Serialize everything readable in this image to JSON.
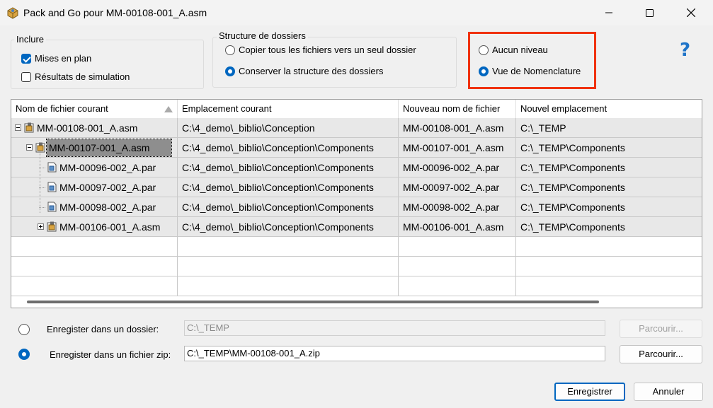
{
  "window": {
    "title": "Pack and Go pour MM-00108-001_A.asm"
  },
  "inclure": {
    "label": "Inclure",
    "options": [
      {
        "label": "Mises en plan",
        "checked": true
      },
      {
        "label": "Résultats de simulation",
        "checked": false
      }
    ]
  },
  "structure": {
    "label": "Structure de dossiers",
    "options": [
      {
        "label": "Copier tous les fichiers vers un seul dossier",
        "selected": false
      },
      {
        "label": "Conserver la structure des dossiers",
        "selected": true
      }
    ]
  },
  "niveau": {
    "options": [
      {
        "label": "Aucun niveau",
        "selected": false
      },
      {
        "label": "Vue de Nomenclature",
        "selected": true
      }
    ]
  },
  "help": {
    "glyph": "?"
  },
  "table": {
    "columns": [
      "Nom de fichier courant",
      "Emplacement courant",
      "Nouveau nom de fichier",
      "Nouvel emplacement"
    ],
    "rows": [
      {
        "name": "MM-00108-001_A.asm",
        "location": "C:\\4_demo\\_biblio\\Conception",
        "new_name": "MM-00108-001_A.asm",
        "new_location": "C:\\_TEMP"
      },
      {
        "name": "MM-00107-001_A.asm",
        "location": "C:\\4_demo\\_biblio\\Conception\\Components",
        "new_name": "MM-00107-001_A.asm",
        "new_location": "C:\\_TEMP\\Components"
      },
      {
        "name": "MM-00096-002_A.par",
        "location": "C:\\4_demo\\_biblio\\Conception\\Components",
        "new_name": "MM-00096-002_A.par",
        "new_location": "C:\\_TEMP\\Components"
      },
      {
        "name": "MM-00097-002_A.par",
        "location": "C:\\4_demo\\_biblio\\Conception\\Components",
        "new_name": "MM-00097-002_A.par",
        "new_location": "C:\\_TEMP\\Components"
      },
      {
        "name": "MM-00098-002_A.par",
        "location": "C:\\4_demo\\_biblio\\Conception\\Components",
        "new_name": "MM-00098-002_A.par",
        "new_location": "C:\\_TEMP\\Components"
      },
      {
        "name": "MM-00106-001_A.asm",
        "location": "C:\\4_demo\\_biblio\\Conception\\Components",
        "new_name": "MM-00106-001_A.asm",
        "new_location": "C:\\_TEMP\\Components"
      }
    ]
  },
  "save_folder": {
    "label": "Enregister dans un dossier:",
    "value": "C:\\_TEMP",
    "browse": "Parcourir...",
    "selected": false
  },
  "save_zip": {
    "label": "Enregister dans un fichier zip:",
    "value": "C:\\_TEMP\\MM-00108-001_A.zip",
    "browse": "Parcourir...",
    "selected": true
  },
  "buttons": {
    "save": "Enregistrer",
    "cancel": "Annuler"
  }
}
